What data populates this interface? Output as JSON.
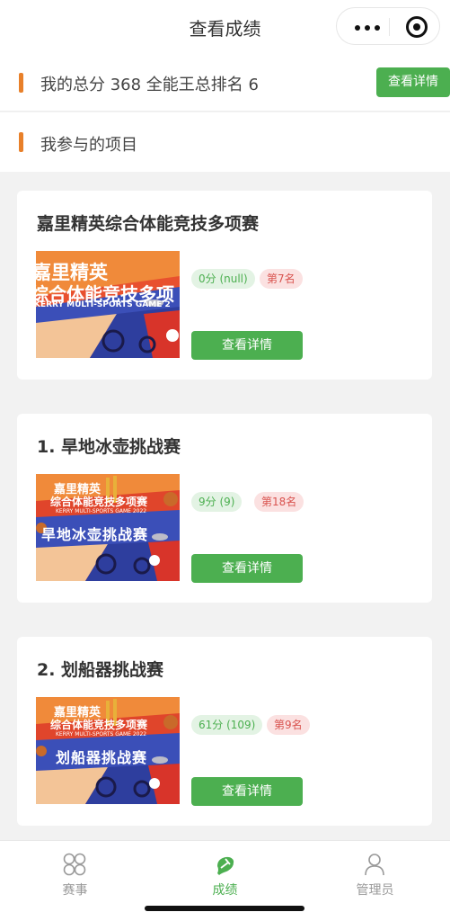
{
  "nav": {
    "title": "查看成绩"
  },
  "summary": {
    "text": "我的总分 368 全能王总排名 6",
    "detail_label": "查看详情"
  },
  "section": {
    "title": "我参与的项目"
  },
  "cards": [
    {
      "title": "嘉里精英综合体能竞技多项赛",
      "thumb": {
        "line1": "嘉里精英",
        "line2": "综合体能竞技多项",
        "en": "KERRY MULTI-SPORTS GAME 2",
        "sub": ""
      },
      "score": "0分 (null)",
      "rank": "第7名",
      "detail_label": "查看详情"
    },
    {
      "title": "1. 旱地冰壶挑战赛",
      "thumb": {
        "line1": "嘉里精英",
        "line2": "综合体能竞技多项赛",
        "en": "KERRY MULTI-SPORTS GAME 2022",
        "sub": "旱地冰壶挑战赛"
      },
      "score": "9分 (9)",
      "rank": "第18名",
      "detail_label": "查看详情"
    },
    {
      "title": "2. 划船器挑战赛",
      "thumb": {
        "line1": "嘉里精英",
        "line2": "综合体能竞技多项赛",
        "en": "KERRY MULTI-SPORTS GAME 2022",
        "sub": "划船器挑战赛"
      },
      "score": "61分 (109)",
      "rank": "第9名",
      "detail_label": "查看详情"
    }
  ],
  "tabbar": {
    "items": [
      {
        "label": "赛事",
        "icon": "events-icon"
      },
      {
        "label": "成绩",
        "icon": "results-icon"
      },
      {
        "label": "管理员",
        "icon": "admin-icon"
      }
    ],
    "active": "成绩"
  },
  "colors": {
    "accent_green": "#4caf50",
    "accent_orange": "#e8802a",
    "rank_red": "#d9534f"
  }
}
